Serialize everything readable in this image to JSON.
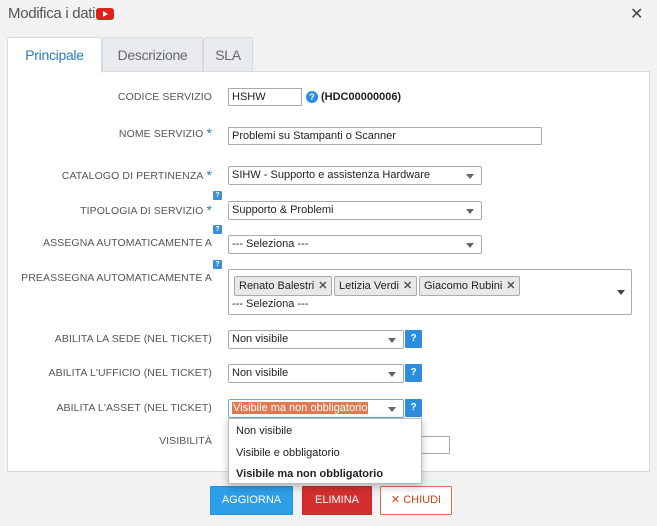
{
  "window": {
    "title": "Modifica i dati",
    "close_glyph": "✕"
  },
  "tabs": [
    {
      "label": "Principale",
      "active": true
    },
    {
      "label": "Descrizione",
      "active": false
    },
    {
      "label": "SLA",
      "active": false
    }
  ],
  "help_glyph": "?",
  "required_glyph": "*",
  "form": {
    "codice_servizio": {
      "label": "CODICE SERVIZIO",
      "value": "HSHW",
      "code": "(HDC00000006)"
    },
    "nome_servizio": {
      "label": "NOME SERVIZIO",
      "value": "Problemi su  Stampanti o Scanner"
    },
    "catalogo": {
      "label": "CATALOGO DI PERTINENZA",
      "value": "SIHW - Supporto e assistenza Hardware"
    },
    "tipologia": {
      "label": "TIPOLOGIA DI SERVIZIO",
      "value": "Supporto & Problemi"
    },
    "assegna": {
      "label": "ASSEGNA AUTOMATICAMENTE A",
      "value": "--- Seleziona ---"
    },
    "preassegna": {
      "label": "PREASSEGNA AUTOMATICAMENTE A",
      "chips": [
        "Renato Balestri",
        "Letizia Verdi",
        "Giacomo Rubini"
      ],
      "chip_remove": "✕",
      "placeholder": "--- Seleziona ---"
    },
    "abilita_sede": {
      "label": "ABILITA LA SEDE (NEL TICKET)",
      "value": "Non visibile"
    },
    "abilita_ufficio": {
      "label": "ABILITA L'UFFICIO (NEL TICKET)",
      "value": "Non visibile"
    },
    "abilita_asset": {
      "label": "ABILITA L'ASSET (NEL TICKET)",
      "value": "Visibile ma non obbligatorio",
      "options": [
        "Non visibile",
        "Visibile e obbligatorio",
        "Visibile ma non obbligatorio"
      ],
      "selected_index": 2
    },
    "visibilita": {
      "label": "VISIBILITÀ"
    }
  },
  "buttons": {
    "update": "AGGIORNA",
    "delete": "ELIMINA",
    "close": "CHIUDI",
    "close_icon_glyph": "✕"
  },
  "colors": {
    "accent": "#2a7ab9",
    "primary_button": "#2d9ee8",
    "danger_button": "#d32f2f",
    "close_button_text": "#d84315",
    "highlight": "#e07850"
  }
}
